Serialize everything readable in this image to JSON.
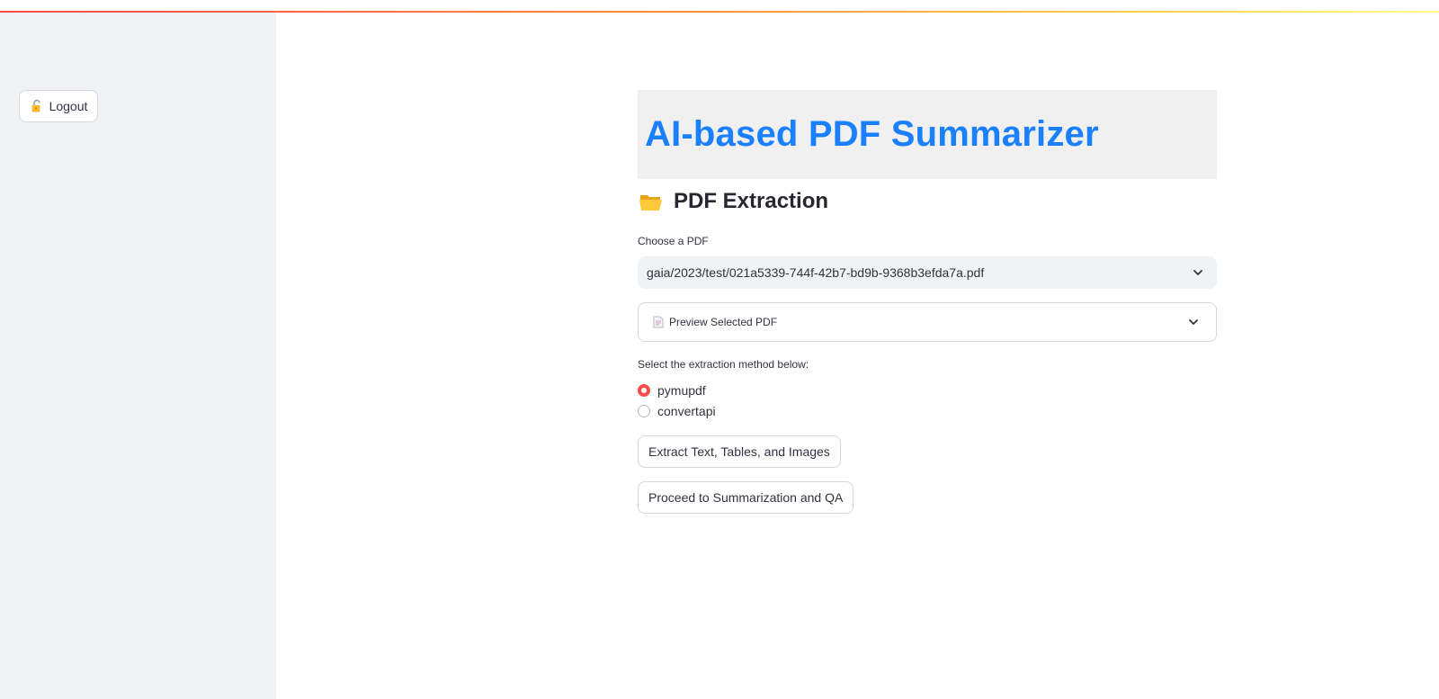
{
  "sidebar": {
    "logout_label": "Logout"
  },
  "main": {
    "title": "AI-based PDF Summarizer",
    "subheader": "PDF Extraction",
    "pdf_select": {
      "label": "Choose a PDF",
      "value": "gaia/2023/test/021a5339-744f-42b7-bd9b-9368b3efda7a.pdf"
    },
    "preview_expander": {
      "label": "Preview Selected PDF"
    },
    "extraction_method": {
      "label": "Select the extraction method below:",
      "options": [
        "pymupdf",
        "convertapi"
      ],
      "selected": "pymupdf"
    },
    "buttons": {
      "extract": "Extract Text, Tables, and Images",
      "proceed": "Proceed to Summarization and QA"
    }
  },
  "colors": {
    "accent": "#ff4b4b",
    "title": "#1a80ff",
    "sidebar_bg": "#f0f2f6"
  },
  "icons": {
    "logout": "unlocked-padlock-icon",
    "subheader": "open-folder-icon",
    "expander": "document-icon",
    "dropdown": "chevron-down-icon"
  }
}
